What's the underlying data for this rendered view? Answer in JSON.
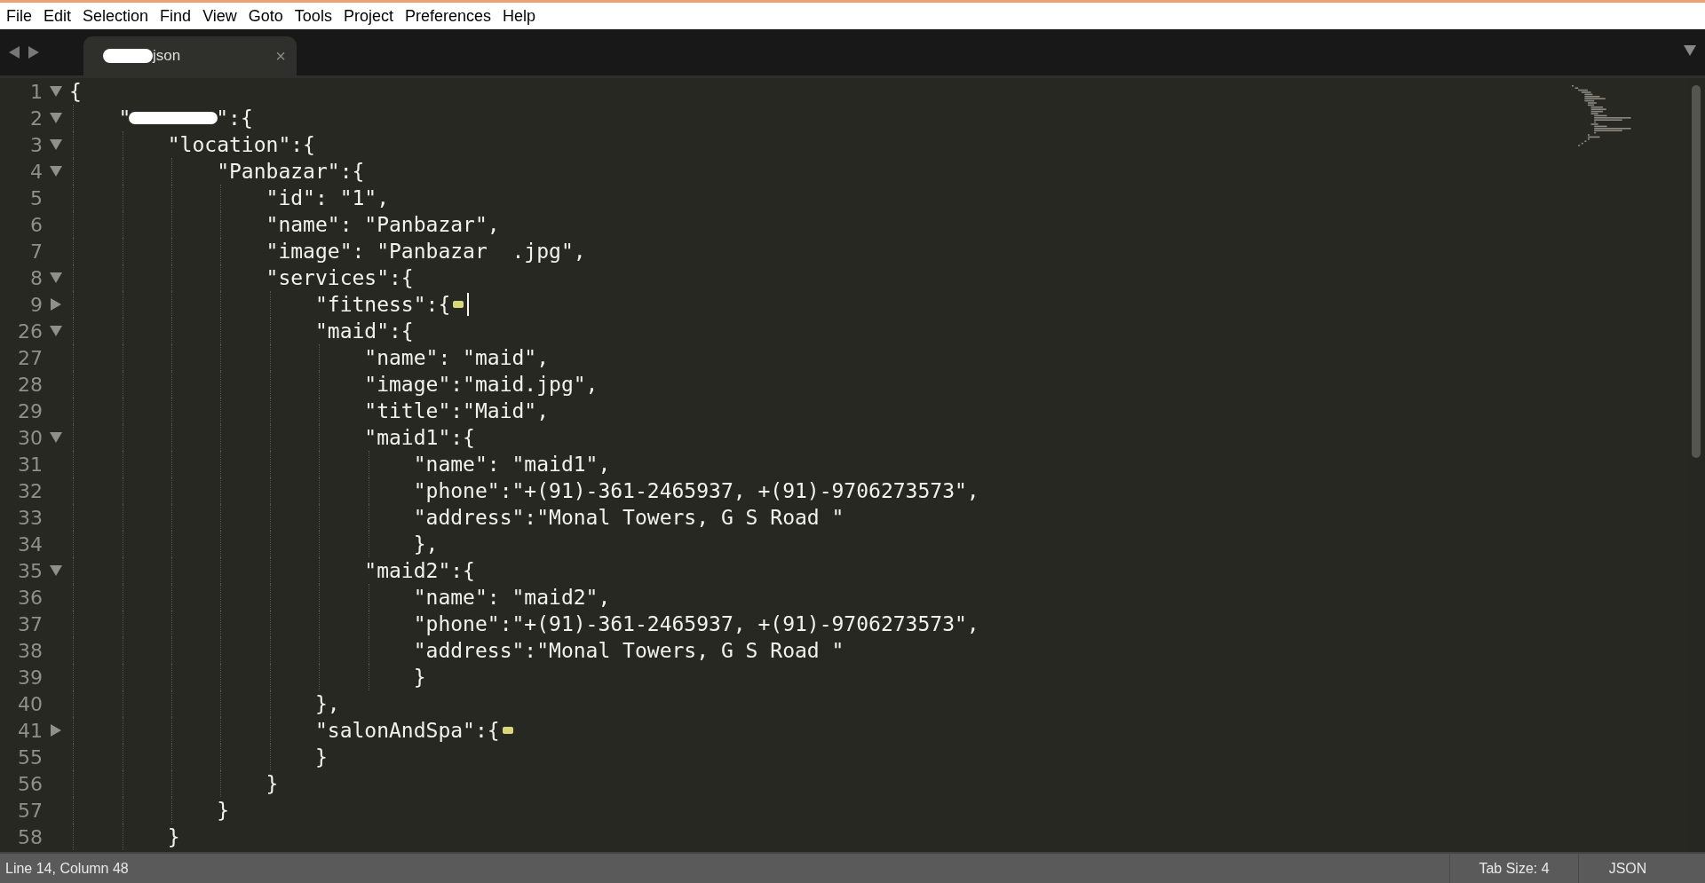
{
  "menu": [
    "File",
    "Edit",
    "Selection",
    "Find",
    "View",
    "Goto",
    "Tools",
    "Project",
    "Preferences",
    "Help"
  ],
  "tabs": [
    {
      "label": "json",
      "redacted": true,
      "selected": true,
      "close": "×"
    }
  ],
  "editor": {
    "lines": [
      {
        "number": "1",
        "kind": "fold",
        "folded": false,
        "text": "{"
      },
      {
        "number": "2",
        "kind": "fold",
        "folded": false,
        "segments": [
          {
            "kind": "text",
            "text": "    \""
          },
          {
            "kind": "redaction"
          },
          {
            "kind": "text",
            "text": "\":{"
          }
        ]
      },
      {
        "number": "3",
        "kind": "fold",
        "folded": false,
        "text": "        \"location\":{"
      },
      {
        "number": "4",
        "kind": "fold",
        "folded": false,
        "text": "            \"Panbazar\":{"
      },
      {
        "number": "5",
        "kind": "plain",
        "text": "                \"id\": \"1\","
      },
      {
        "number": "6",
        "kind": "plain",
        "text": "                \"name\": \"Panbazar\","
      },
      {
        "number": "7",
        "kind": "plain",
        "text": "                \"image\": \"Panbazar  .jpg\","
      },
      {
        "number": "8",
        "kind": "fold",
        "folded": false,
        "text": "                \"services\":{"
      },
      {
        "number": "9",
        "kind": "fold",
        "folded": true,
        "cursor": true,
        "text": "                    \"fitness\":{"
      },
      {
        "number": "26",
        "kind": "fold",
        "folded": false,
        "text": "                    \"maid\":{"
      },
      {
        "number": "27",
        "kind": "plain",
        "text": "                        \"name\": \"maid\","
      },
      {
        "number": "28",
        "kind": "plain",
        "text": "                        \"image\":\"maid.jpg\","
      },
      {
        "number": "29",
        "kind": "plain",
        "text": "                        \"title\":\"Maid\","
      },
      {
        "number": "30",
        "kind": "fold",
        "folded": false,
        "text": "                        \"maid1\":{"
      },
      {
        "number": "31",
        "kind": "plain",
        "text": "                            \"name\": \"maid1\","
      },
      {
        "number": "32",
        "kind": "plain",
        "text": "                            \"phone\":\"+(91)-361-2465937, +(91)-9706273573\","
      },
      {
        "number": "33",
        "kind": "plain",
        "text": "                            \"address\":\"Monal Towers, G S Road \""
      },
      {
        "number": "34",
        "kind": "plain",
        "text": "                            },"
      },
      {
        "number": "35",
        "kind": "fold",
        "folded": false,
        "text": "                        \"maid2\":{"
      },
      {
        "number": "36",
        "kind": "plain",
        "text": "                            \"name\": \"maid2\","
      },
      {
        "number": "37",
        "kind": "plain",
        "text": "                            \"phone\":\"+(91)-361-2465937, +(91)-9706273573\","
      },
      {
        "number": "38",
        "kind": "plain",
        "text": "                            \"address\":\"Monal Towers, G S Road \""
      },
      {
        "number": "39",
        "kind": "plain",
        "text": "                            }"
      },
      {
        "number": "40",
        "kind": "plain",
        "text": "                    },"
      },
      {
        "number": "41",
        "kind": "fold",
        "folded": true,
        "text": "                    \"salonAndSpa\":{"
      },
      {
        "number": "55",
        "kind": "plain",
        "text": "                    }"
      },
      {
        "number": "56",
        "kind": "plain",
        "text": "                }"
      },
      {
        "number": "57",
        "kind": "plain",
        "text": "            }"
      },
      {
        "number": "58",
        "kind": "plain",
        "text": "        }"
      }
    ]
  },
  "status_bar": {
    "position": "Line 14, Column 48",
    "tab_size": "Tab Size: 4",
    "syntax": "JSON"
  }
}
